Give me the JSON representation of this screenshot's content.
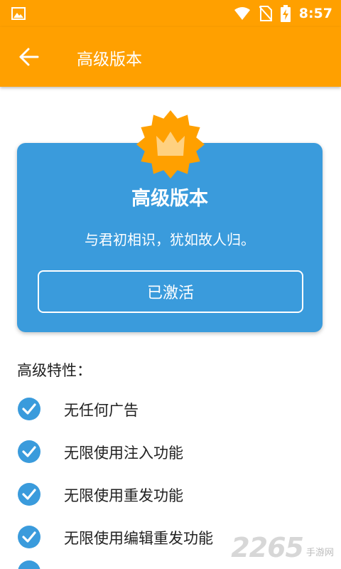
{
  "status_bar": {
    "time": "8:57"
  },
  "app_bar": {
    "title": "高级版本"
  },
  "premium_card": {
    "title": "高级版本",
    "subtitle": "与君初相识，犹如故人归。",
    "button_label": "已激活"
  },
  "features": {
    "heading": "高级特性：",
    "items": [
      {
        "label": "无任何广告"
      },
      {
        "label": "无限使用注入功能"
      },
      {
        "label": "无限使用重发功能"
      },
      {
        "label": "无限使用编辑重发功能"
      }
    ]
  },
  "watermark": {
    "digits": "2265",
    "site": "手游网"
  },
  "colors": {
    "accent": "#FFA000",
    "card": "#3A9BDC",
    "check": "#3A9BDC"
  }
}
